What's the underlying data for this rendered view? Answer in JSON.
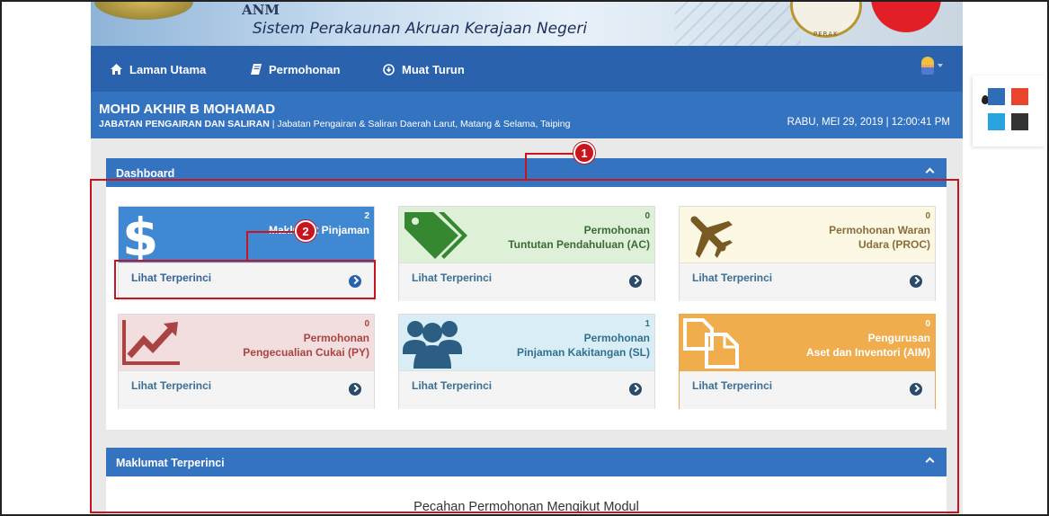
{
  "banner": {
    "abbr": "ANM",
    "title": "Sistem Perakaunan Akruan Kerajaan Negeri",
    "state_label": "PERAK"
  },
  "nav": {
    "items": [
      {
        "label": "Laman Utama",
        "icon": "home-icon"
      },
      {
        "label": "Permohonan",
        "icon": "book-icon"
      },
      {
        "label": "Muat Turun",
        "icon": "download-icon"
      }
    ],
    "user_icon": "user-avatar-icon"
  },
  "info": {
    "name": "MOHD AKHIR B MOHAMAD",
    "dept_main": "JABATAN PENGAIRAN DAN SALIRAN",
    "dept_sub": " | Jabatan Pengairan & Saliran Daerah Larut, Matang & Selama, Taiping",
    "datetime": "RABU, MEI 29, 2019 | 12:00:41 PM"
  },
  "dashboard": {
    "title": "Dashboard",
    "cards": [
      {
        "count": "2",
        "line1": "Maklumat Pinjaman",
        "line2": "",
        "link": "Lihat Terperinci",
        "icon": "dollar-icon",
        "theme": "blue"
      },
      {
        "count": "0",
        "line1": "Permohonan",
        "line2": "Tuntutan Pendahuluan (AC)",
        "link": "Lihat Terperinci",
        "icon": "tag-icon",
        "theme": "green"
      },
      {
        "count": "0",
        "line1": "Permohonan Waran",
        "line2": "Udara (PROC)",
        "link": "Lihat Terperinci",
        "icon": "plane-icon",
        "theme": "yellow"
      },
      {
        "count": "0",
        "line1": "Permohonan",
        "line2": "Pengecualian Cukai (PY)",
        "link": "Lihat Terperinci",
        "icon": "chart-trend-icon",
        "theme": "red"
      },
      {
        "count": "1",
        "line1": "Permohonan",
        "line2": "Pinjaman Kakitangan (SL)",
        "link": "Lihat Terperinci",
        "icon": "users-icon",
        "theme": "lightblue"
      },
      {
        "count": "0",
        "line1": "Pengurusan",
        "line2": "Aset dan Inventori (AIM)",
        "link": "Lihat Terperinci",
        "icon": "copy-icon",
        "theme": "orange"
      }
    ]
  },
  "details": {
    "title": "Maklumat Terperinci",
    "body_title": "Pecahan Permohonan Mengikut Modul"
  },
  "annotations": {
    "one": "1",
    "two": "2"
  },
  "theme_widget": {
    "colors": [
      "#2f6db5",
      "#e8452c",
      "#29a3e0",
      "#333333"
    ]
  }
}
